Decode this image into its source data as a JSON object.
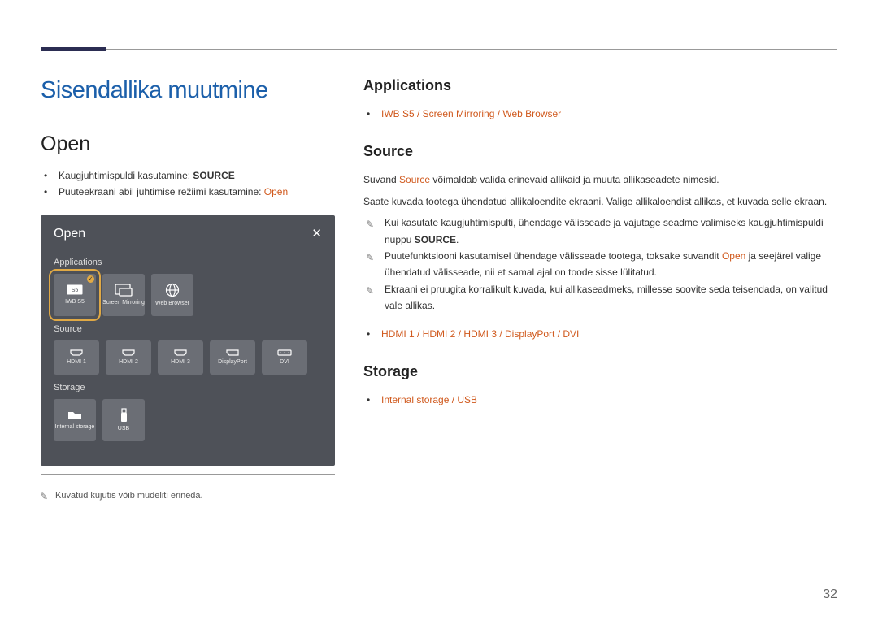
{
  "page": {
    "number": "32",
    "h1": "Sisendallika muutmine",
    "left_h2": "Open",
    "footnote": "Kuvatud kujutis võib mudeliti erineda."
  },
  "left_bullets": {
    "b1_pre": "Kaugjuhtimispuldi kasutamine: ",
    "b1_bold": "SOURCE",
    "b2_pre": "Puuteekraani abil juhtimise režiimi kasutamine: ",
    "b2_em": "Open"
  },
  "screenshot": {
    "title": "Open",
    "sections": {
      "applications": {
        "label": "Applications",
        "tiles": {
          "iwb": "IWB S5",
          "mirroring": "Screen Mirroring",
          "browser": "Web Browser"
        }
      },
      "source": {
        "label": "Source",
        "tiles": {
          "hdmi1": "HDMI 1",
          "hdmi2": "HDMI 2",
          "hdmi3": "HDMI 3",
          "dp": "DisplayPort",
          "dvi": "DVI"
        }
      },
      "storage": {
        "label": "Storage",
        "tiles": {
          "internal": "Internal storage",
          "usb": "USB"
        }
      }
    }
  },
  "right": {
    "applications": {
      "heading": "Applications",
      "list": "IWB S5 / Screen Mirroring / Web Browser"
    },
    "source": {
      "heading": "Source",
      "p1_a": "Suvand ",
      "p1_em": "Source",
      "p1_b": " võimaldab valida erinevaid allikaid ja muuta allikaseadete nimesid.",
      "p2": "Saate kuvada tootega ühendatud allikaloendite ekraani. Valige allikaloendist allikas, et kuvada selle ekraan.",
      "n1_a": "Kui kasutate kaugjuhtimispulti, ühendage välisseade ja vajutage seadme valimiseks kaugjuhtimispuldi nuppu ",
      "n1_bold": "SOURCE",
      "n1_b": ".",
      "n2_a": "Puutefunktsiooni kasutamisel ühendage välisseade tootega, toksake suvandit ",
      "n2_em": "Open",
      "n2_b": " ja seejärel valige ühendatud välisseade, nii et samal ajal on toode sisse lülitatud.",
      "n3": "Ekraani ei pruugita korralikult kuvada, kui allikaseadmeks, millesse soovite seda teisendada, on valitud vale allikas.",
      "ports": "HDMI 1 / HDMI 2 / HDMI 3 / DisplayPort / DVI"
    },
    "storage": {
      "heading": "Storage",
      "list": "Internal storage / USB"
    }
  }
}
